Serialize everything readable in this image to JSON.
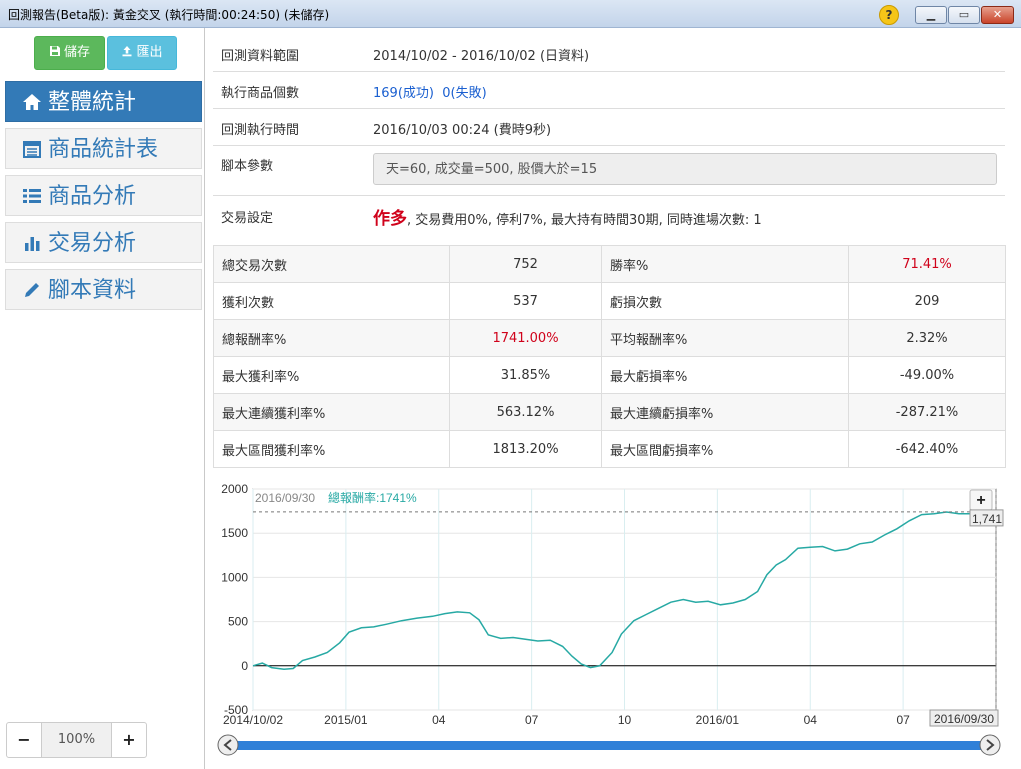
{
  "window": {
    "title": "回測報告(Beta版): 黃金交叉 (執行時間:00:24:50) (未儲存)",
    "help": "?",
    "min": "▁",
    "max": "▭",
    "close": "✕"
  },
  "toolbar": {
    "save_label": "儲存",
    "export_label": "匯出"
  },
  "nav": [
    {
      "label": "整體統計",
      "icon": "home-icon",
      "active": true
    },
    {
      "label": "商品統計表",
      "icon": "table-icon",
      "active": false
    },
    {
      "label": "商品分析",
      "icon": "list-icon",
      "active": false
    },
    {
      "label": "交易分析",
      "icon": "bar-chart-icon",
      "active": false
    },
    {
      "label": "腳本資料",
      "icon": "pencil-icon",
      "active": false
    }
  ],
  "zoom": {
    "minus": "−",
    "value": "100%",
    "plus": "+"
  },
  "info": {
    "range_label": "回測資料範圍",
    "range_value": "2014/10/02 - 2016/10/02 (日資料)",
    "count_label": "執行商品個數",
    "count_success": "169(成功)",
    "count_fail": "0(失敗)",
    "time_label": "回測執行時間",
    "time_value": "2016/10/03 00:24 (費時9秒)",
    "param_label": "腳本參數",
    "param_value": "天=60, 成交量=500, 股價大於=15",
    "trade_label": "交易設定",
    "trade_dir": "作多",
    "trade_value": ", 交易費用0%, 停利7%, 最大持有時間30期, 同時進場次數: 1"
  },
  "stats": [
    [
      "總交易次數",
      "752",
      "勝率%",
      "71.41%"
    ],
    [
      "獲利次數",
      "537",
      "虧損次數",
      "209"
    ],
    [
      "總報酬率%",
      "1741.00%",
      "平均報酬率%",
      "2.32%"
    ],
    [
      "最大獲利率%",
      "31.85%",
      "最大虧損率%",
      "-49.00%"
    ],
    [
      "最大連續獲利率%",
      "563.12%",
      "最大連續虧損率%",
      "-287.21%"
    ],
    [
      "最大區間獲利率%",
      "1813.20%",
      "最大區間虧損率%",
      "-642.40%"
    ]
  ],
  "colors": {
    "accent": "#337ab7",
    "red": "#d0021b",
    "line": "#27a9a4",
    "nav_bar": "#2f80d8"
  },
  "chart_data": {
    "type": "line",
    "tooltip_date": "2016/09/30",
    "tooltip_label": "總報酬率:1741%",
    "last_value_label": "1,741",
    "end_date_label": "2016/09/30",
    "zoom_button": "+",
    "ylim": [
      -500,
      2000
    ],
    "yticks": [
      2000,
      1500,
      1000,
      500,
      0,
      -500
    ],
    "xticks": [
      {
        "t": 0,
        "label": "2014/10/02"
      },
      {
        "t": 3,
        "label": "2015/01"
      },
      {
        "t": 6,
        "label": "04"
      },
      {
        "t": 9,
        "label": "07"
      },
      {
        "t": 12,
        "label": "10"
      },
      {
        "t": 15,
        "label": "2016/01"
      },
      {
        "t": 18,
        "label": "04"
      },
      {
        "t": 21,
        "label": "07"
      }
    ],
    "x_range": [
      0,
      24
    ],
    "series": [
      {
        "points": [
          [
            0,
            0
          ],
          [
            0.3,
            30
          ],
          [
            0.6,
            -20
          ],
          [
            1,
            -40
          ],
          [
            1.3,
            -30
          ],
          [
            1.6,
            60
          ],
          [
            2,
            100
          ],
          [
            2.4,
            150
          ],
          [
            2.8,
            260
          ],
          [
            3.1,
            380
          ],
          [
            3.5,
            430
          ],
          [
            3.9,
            440
          ],
          [
            4.3,
            470
          ],
          [
            4.8,
            510
          ],
          [
            5.3,
            540
          ],
          [
            5.8,
            560
          ],
          [
            6.2,
            590
          ],
          [
            6.6,
            610
          ],
          [
            7,
            600
          ],
          [
            7.3,
            520
          ],
          [
            7.6,
            350
          ],
          [
            8,
            310
          ],
          [
            8.4,
            320
          ],
          [
            8.8,
            300
          ],
          [
            9.2,
            280
          ],
          [
            9.6,
            290
          ],
          [
            10,
            220
          ],
          [
            10.3,
            110
          ],
          [
            10.6,
            20
          ],
          [
            10.9,
            -20
          ],
          [
            11.2,
            0
          ],
          [
            11.6,
            150
          ],
          [
            11.9,
            360
          ],
          [
            12.3,
            510
          ],
          [
            12.7,
            580
          ],
          [
            13.1,
            650
          ],
          [
            13.5,
            720
          ],
          [
            13.9,
            750
          ],
          [
            14.3,
            720
          ],
          [
            14.7,
            730
          ],
          [
            15.1,
            690
          ],
          [
            15.5,
            710
          ],
          [
            15.9,
            750
          ],
          [
            16.3,
            840
          ],
          [
            16.6,
            1030
          ],
          [
            16.9,
            1140
          ],
          [
            17.2,
            1200
          ],
          [
            17.6,
            1330
          ],
          [
            18,
            1340
          ],
          [
            18.4,
            1350
          ],
          [
            18.8,
            1300
          ],
          [
            19.2,
            1320
          ],
          [
            19.6,
            1380
          ],
          [
            20,
            1400
          ],
          [
            20.4,
            1480
          ],
          [
            20.8,
            1550
          ],
          [
            21.2,
            1640
          ],
          [
            21.6,
            1710
          ],
          [
            22,
            1720
          ],
          [
            22.4,
            1740
          ],
          [
            22.8,
            1720
          ],
          [
            23.2,
            1720
          ],
          [
            23.6,
            1710
          ],
          [
            24,
            1741
          ]
        ]
      }
    ]
  }
}
